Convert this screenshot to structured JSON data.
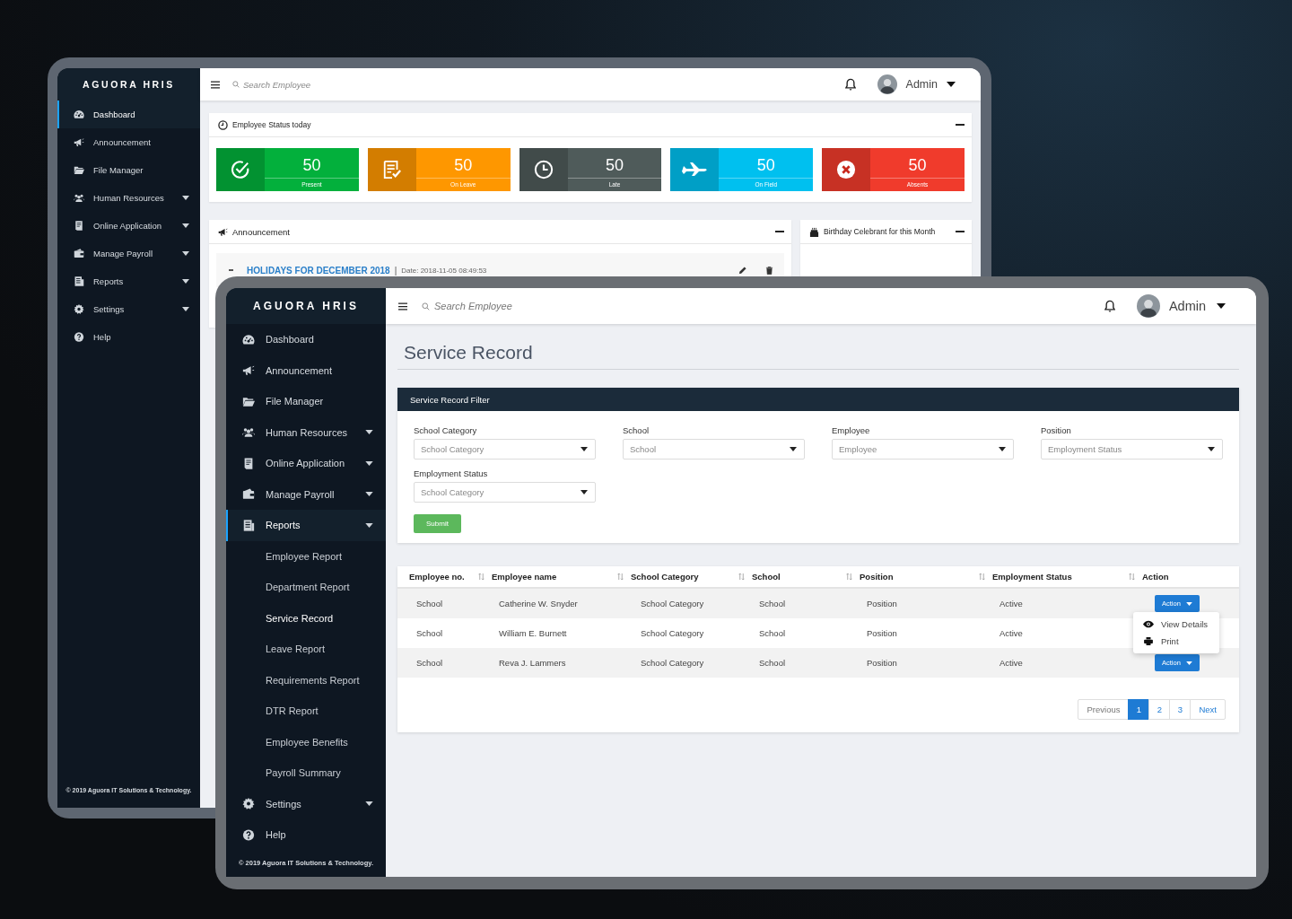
{
  "back_screen": {
    "brand": "AGUORA HRIS",
    "search_placeholder": "Search Employee",
    "user_name": "Admin",
    "sidebar": [
      {
        "label": "Dashboard",
        "kind": "dashboard",
        "expandable": false,
        "selected": true
      },
      {
        "label": "Announcement",
        "kind": "announcement",
        "expandable": false,
        "selected": false
      },
      {
        "label": "File Manager",
        "kind": "folder",
        "expandable": false,
        "selected": false
      },
      {
        "label": "Human Resources",
        "kind": "people",
        "expandable": true,
        "selected": false
      },
      {
        "label": "Online Application",
        "kind": "document",
        "expandable": true,
        "selected": false
      },
      {
        "label": "Manage Payroll",
        "kind": "wallet",
        "expandable": true,
        "selected": false
      },
      {
        "label": "Reports",
        "kind": "report",
        "expandable": true,
        "selected": false
      },
      {
        "label": "Settings",
        "kind": "settings",
        "expandable": true,
        "selected": false
      },
      {
        "label": "Help",
        "kind": "help",
        "expandable": false,
        "selected": false
      }
    ],
    "footer": "© 2019 Aguora IT Solutions & Technology.",
    "status_card": {
      "title": "Employee Status today",
      "stats": [
        {
          "value": "50",
          "label": "Present",
          "kind": "check",
          "color": "#03b03c"
        },
        {
          "value": "50",
          "label": "On Leave",
          "kind": "form",
          "color": "#fe9700"
        },
        {
          "value": "50",
          "label": "Late",
          "kind": "clock",
          "color": "#4f5b5a"
        },
        {
          "value": "50",
          "label": "On Field",
          "kind": "plane",
          "color": "#00c0ef"
        },
        {
          "value": "50",
          "label": "Absents",
          "kind": "cross",
          "color": "#f03b2c"
        }
      ]
    },
    "announcement_card": {
      "title": "Announcement",
      "items": [
        {
          "title": "HOLIDAYS FOR DECEMBER 2018",
          "separator": "|",
          "date": "Date: 2018-11-05 08:49:53"
        }
      ]
    },
    "birthday_card": {
      "title": "Birthday Celebrant for this Month"
    }
  },
  "front_screen": {
    "brand": "AGUORA HRIS",
    "search_placeholder": "Search Employee",
    "user_name": "Admin",
    "sidebar": [
      {
        "label": "Dashboard",
        "kind": "dashboard",
        "expandable": false,
        "selected": false
      },
      {
        "label": "Announcement",
        "kind": "announcement",
        "expandable": false,
        "selected": false
      },
      {
        "label": "File Manager",
        "kind": "folder",
        "expandable": false,
        "selected": false
      },
      {
        "label": "Human Resources",
        "kind": "people",
        "expandable": true,
        "selected": false
      },
      {
        "label": "Online Application",
        "kind": "document",
        "expandable": true,
        "selected": false
      },
      {
        "label": "Manage Payroll",
        "kind": "wallet",
        "expandable": true,
        "selected": false
      },
      {
        "label": "Reports",
        "kind": "report",
        "expandable": true,
        "selected": true,
        "expanded": true,
        "children": [
          {
            "label": "Employee Report",
            "selected": false
          },
          {
            "label": "Department Report",
            "selected": false
          },
          {
            "label": "Service Record",
            "selected": true
          },
          {
            "label": "Leave Report",
            "selected": false
          },
          {
            "label": "Requirements Report",
            "selected": false
          },
          {
            "label": "DTR Report",
            "selected": false
          },
          {
            "label": "Employee Benefits",
            "selected": false
          },
          {
            "label": "Payroll Summary",
            "selected": false
          }
        ]
      },
      {
        "label": "Settings",
        "kind": "settings",
        "expandable": true,
        "selected": false
      },
      {
        "label": "Help",
        "kind": "help",
        "expandable": false,
        "selected": false
      }
    ],
    "footer": "© 2019 Aguora IT Solutions & Technology.",
    "page_title": "Service Record",
    "filter": {
      "title": "Service Record Filter",
      "fields": [
        {
          "label": "School Category",
          "placeholder": "School Category"
        },
        {
          "label": "School",
          "placeholder": "School"
        },
        {
          "label": "Employee",
          "placeholder": "Employee"
        },
        {
          "label": "Position",
          "placeholder": "Employment Status"
        },
        {
          "label": "Employment Status",
          "placeholder": "School Category"
        }
      ],
      "submit": "Submit"
    },
    "table": {
      "columns": [
        {
          "label": "Employee no.",
          "sortable": true
        },
        {
          "label": "Employee name",
          "sortable": true
        },
        {
          "label": "School Category",
          "sortable": true
        },
        {
          "label": "School",
          "sortable": true
        },
        {
          "label": "Position",
          "sortable": true
        },
        {
          "label": "Employment Status",
          "sortable": true
        },
        {
          "label": "Action",
          "sortable": false
        }
      ],
      "rows": [
        {
          "cells": [
            "School",
            "Catherine W. Snyder",
            "School Category",
            "School",
            "Position",
            "Active"
          ],
          "action": "Action"
        },
        {
          "cells": [
            "School",
            "William E. Burnett",
            "School Category",
            "School",
            "Position",
            "Active"
          ]
        },
        {
          "cells": [
            "School",
            "Reva J. Lammers",
            "School Category",
            "School",
            "Position",
            "Active"
          ],
          "action": "Action"
        }
      ],
      "action_menu": {
        "open": true,
        "items": [
          {
            "label": "View Details",
            "kind": "view"
          },
          {
            "label": "Print",
            "kind": "print"
          }
        ]
      },
      "pagination": {
        "previous": "Previous",
        "pages": [
          {
            "label": "1",
            "selected": true
          },
          {
            "label": "2",
            "selected": false
          },
          {
            "label": "3",
            "selected": false
          }
        ],
        "next": "Next"
      }
    }
  }
}
